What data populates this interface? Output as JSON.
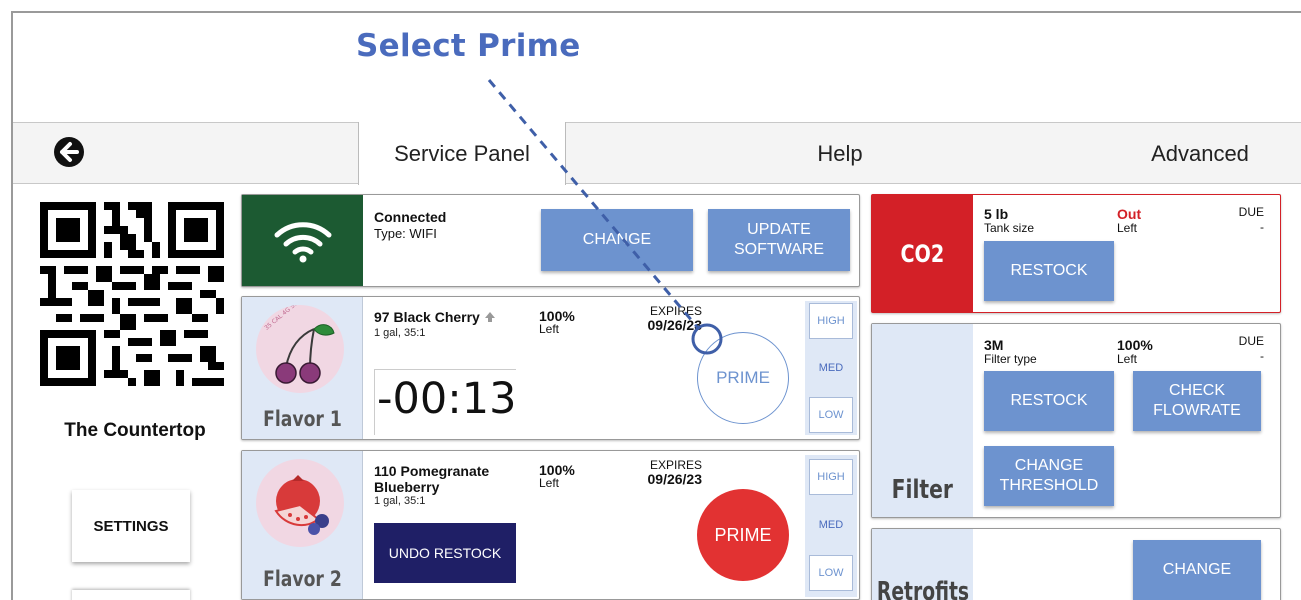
{
  "instruction": "Select Prime",
  "nav": {
    "tabs": [
      {
        "label": "Service Panel"
      },
      {
        "label": "Help"
      },
      {
        "label": "Advanced"
      }
    ]
  },
  "sidebar": {
    "location_name": "The Countertop",
    "settings_label": "SETTINGS"
  },
  "wifi": {
    "status": "Connected",
    "type": "Type: WIFI",
    "change_label": "CHANGE",
    "update_line1": "UPDATE",
    "update_line2": "SOFTWARE"
  },
  "flavors": [
    {
      "slot": "Flavor 1",
      "name": "97 Black Cherry",
      "size": "1 gal, 35:1",
      "percent": "100%",
      "percent_sub": "Left",
      "expires_label": "EXPIRES",
      "expires": "09/26/23",
      "timer": "-00:13",
      "prime_label": "PRIME",
      "levels": [
        "HIGH",
        "MED",
        "LOW"
      ],
      "selected_level": "MED",
      "badge_text": "35 CAL 4G SUGAR"
    },
    {
      "slot": "Flavor 2",
      "name_line1": "110 Pomegranate",
      "name_line2": "Blueberry",
      "size": "1 gal, 35:1",
      "percent": "100%",
      "percent_sub": "Left",
      "expires_label": "EXPIRES",
      "expires": "09/26/23",
      "undo_label": "UNDO RESTOCK",
      "prime_label": "PRIME",
      "levels": [
        "HIGH",
        "MED",
        "LOW"
      ],
      "selected_level": "MED"
    }
  ],
  "co2": {
    "title": "CO2",
    "tank_value": "5 lb",
    "tank_label": "Tank size",
    "left_value": "Out",
    "left_label": "Left",
    "due_label": "DUE",
    "due_value": "-",
    "restock_label": "RESTOCK"
  },
  "filter": {
    "title": "Filter",
    "type_value": "3M",
    "type_label": "Filter type",
    "left_value": "100%",
    "left_label": "Left",
    "due_label": "DUE",
    "due_value": "-",
    "restock_label": "RESTOCK",
    "check_line1": "CHECK",
    "check_line2": "FLOWRATE",
    "threshold_line1": "CHANGE",
    "threshold_line2": "THRESHOLD"
  },
  "retrofits": {
    "title": "Retrofits",
    "change_label": "CHANGE"
  },
  "colors": {
    "accent_blue": "#6d93cf",
    "instruction_blue": "#4a6bbd",
    "wifi_green": "#1c5a32",
    "co2_red": "#d32027",
    "prime_red": "#e23232",
    "undo_navy": "#1f1f66",
    "panel_light_blue": "#dfe8f6"
  },
  "icons": {
    "back": "arrow-left-circle-icon",
    "wifi": "wifi-icon",
    "qr": "qr-code-icon",
    "up": "arrow-up-icon"
  }
}
